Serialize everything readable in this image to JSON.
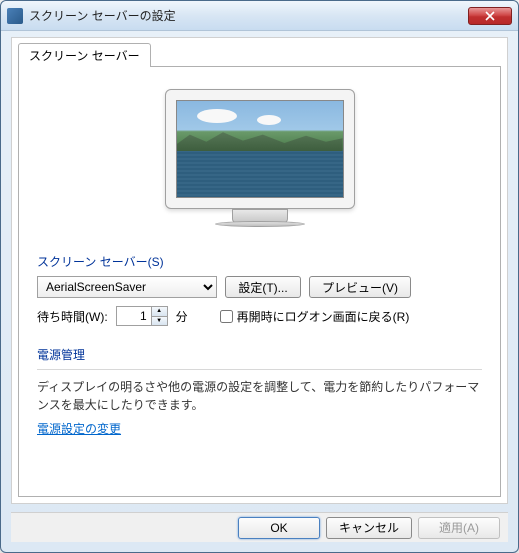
{
  "window": {
    "title": "スクリーン セーバーの設定"
  },
  "tabs": {
    "main": "スクリーン セーバー"
  },
  "screensaver": {
    "group_label": "スクリーン セーバー(S)",
    "selected": "AerialScreenSaver",
    "settings_btn": "設定(T)...",
    "preview_btn": "プレビュー(V)",
    "wait_label": "待ち時間(W):",
    "wait_value": "1",
    "wait_unit": "分",
    "resume_checkbox": "再開時にログオン画面に戻る(R)",
    "resume_checked": false
  },
  "power": {
    "group_label": "電源管理",
    "description": "ディスプレイの明るさや他の電源の設定を調整して、電力を節約したりパフォーマンスを最大にしたりできます。",
    "link": "電源設定の変更"
  },
  "buttons": {
    "ok": "OK",
    "cancel": "キャンセル",
    "apply": "適用(A)"
  }
}
